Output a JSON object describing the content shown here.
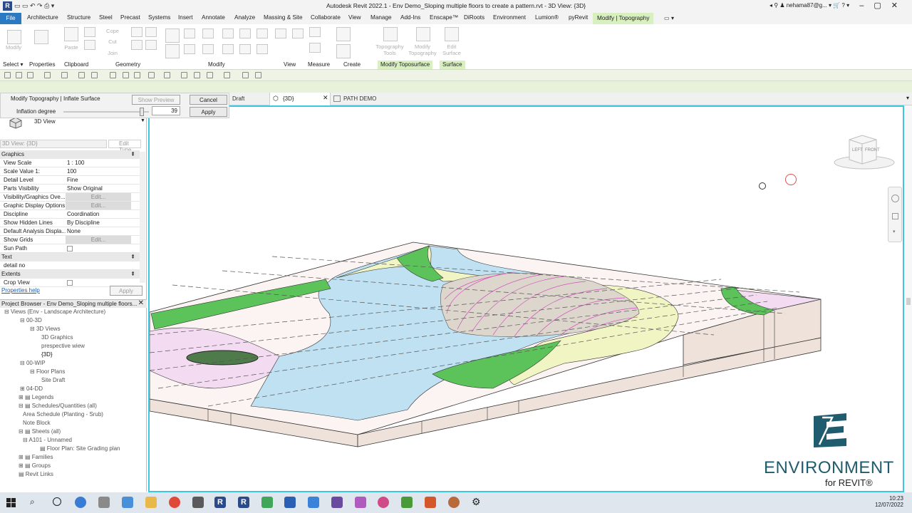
{
  "window": {
    "title": "Autodesk Revit 2022.1 - Env Demo_Sloping multiple floors to create a pattern.rvt - 3D View: {3D}",
    "user": "nehama87@g...",
    "logo": "R"
  },
  "ribbon_tabs": [
    "File",
    "Architecture",
    "Structure",
    "Steel",
    "Precast",
    "Systems",
    "Insert",
    "Annotate",
    "Analyze",
    "Massing & Site",
    "Collaborate",
    "View",
    "Manage",
    "Add-Ins",
    "Enscape™",
    "DiRoots",
    "Environment",
    "Lumion®",
    "pyRevit",
    "Modify | Topography"
  ],
  "ribbon": {
    "tool_labels": [
      "Modify",
      "Paste",
      "Cope",
      "Cut",
      "Join",
      "Topography Tools",
      "Modify Topography",
      "Edit Surface"
    ],
    "panels": [
      "Select ▾",
      "Properties",
      "Clipboard",
      "Geometry",
      "Modify",
      "View",
      "Measure",
      "Create",
      "Modify Toposurface",
      "Surface"
    ]
  },
  "inflate_dialog": {
    "title": "Modify Topography | Inflate Surface",
    "show_preview": "Show Preview",
    "cancel": "Cancel",
    "inflation_label": "Inflation degree",
    "inflation_value": "39",
    "inflation_level": 0.92,
    "apply": "Apply"
  },
  "properties": {
    "type_name": "3D View",
    "instance_selector": "3D View: {3D}",
    "edit_type": "Edit Type",
    "sections": {
      "graphics": "Graphics",
      "text": "Text",
      "extents": "Extents"
    },
    "rows": [
      {
        "k": "View Scale",
        "v": "1 : 100"
      },
      {
        "k": "Scale Value    1:",
        "v": "100"
      },
      {
        "k": "Detail Level",
        "v": "Fine"
      },
      {
        "k": "Parts Visibility",
        "v": "Show Original"
      },
      {
        "k": "Visibility/Graphics Ove...",
        "v": "Edit..."
      },
      {
        "k": "Graphic Display Options",
        "v": "Edit..."
      },
      {
        "k": "Discipline",
        "v": "Coordination"
      },
      {
        "k": "Show Hidden Lines",
        "v": "By Discipline"
      },
      {
        "k": "Default Analysis Displa...",
        "v": "None"
      },
      {
        "k": "Show Grids",
        "v": "Edit..."
      },
      {
        "k": "Sun Path",
        "v": ""
      }
    ],
    "text_row": {
      "k": "detail no",
      "v": ""
    },
    "extents_row": {
      "k": "Crop View",
      "v": ""
    },
    "help": "Properties help",
    "apply": "Apply"
  },
  "project_browser": {
    "title": "Project Browser - Env Demo_Sloping multiple floors...",
    "items": [
      "Views (Env - Landscape Architecture)",
      "00-3D",
      "3D Views",
      "3D Graphics",
      "prespective wiew",
      "{3D}",
      "00-WIP",
      "Floor Plans",
      "Site Draft",
      "04-DD",
      "Legends",
      "Schedules/Quantities (all)",
      "Area Schedule (Planting - Srub)",
      "Note Block",
      "Sheets (all)",
      "A101 - Unnamed",
      "Floor Plan: Site Grading plan",
      "Families",
      "Groups",
      "Revit Links"
    ]
  },
  "view_tabs": [
    "Draft",
    "{3D}",
    "PATH DEMO"
  ],
  "viewcube": {
    "left": "LEFT",
    "front": "FRONT"
  },
  "brand": {
    "line1": "ENVIRONMENT",
    "line2": "for REVIT®"
  },
  "clock": {
    "time": "10:23",
    "date": "12/07/2022"
  },
  "colors": {
    "accent": "#3cc7e0",
    "file_tab": "#2b79c2",
    "context_tab": "#d8f0c0",
    "water": "#bfe1f2",
    "grass": "#5cc35a",
    "sand": "#f1f5c4",
    "pink": "#f3dcf2",
    "soil": "#efe2da",
    "brand": "#1f5d6e"
  }
}
